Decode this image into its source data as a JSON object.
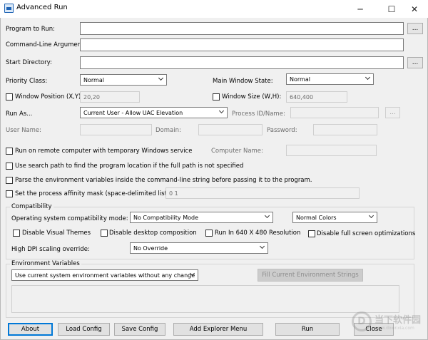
{
  "window": {
    "title": "Advanced Run",
    "minimize": "─",
    "maximize": "☐",
    "close": "✕"
  },
  "labels": {
    "program": "Program to Run:",
    "args": "Command-Line Arguments:",
    "startdir": "Start Directory:",
    "priority": "Priority Class:",
    "main_window_state": "Main Window State:",
    "window_position": "Window Position (X,Y):",
    "window_size": "Window Size (W,H):",
    "run_as": "Run As...",
    "process_id": "Process ID/Name:",
    "user_name": "User Name:",
    "domain": "Domain:",
    "password": "Password:",
    "computer_name": "Computer Name:"
  },
  "values": {
    "program": "",
    "args": "",
    "startdir": "",
    "priority": "Normal",
    "main_window_state": "Normal",
    "window_position": "20,20",
    "window_size": "640,400",
    "run_as": "Current User - Allow UAC Elevation",
    "affinity_mask": "0 1"
  },
  "browse": "...",
  "checkboxes": {
    "remote": "Run on remote computer with temporary Windows service",
    "search_path": "Use search path to find the program location if the full path is not specified",
    "parse_env": "Parse the environment variables inside the command-line string before passing it to the program.",
    "affinity": "Set the process affinity mask (space-delimited list):"
  },
  "compatibility": {
    "legend": "Compatibility",
    "os_mode_label": "Operating system compatibility mode:",
    "os_mode": "No Compatibility Mode",
    "colors": "Normal Colors",
    "disable_visual_themes": "Disable Visual Themes",
    "disable_desktop_composition": "Disable desktop composition",
    "run_640": "Run In 640 X 480 Resolution",
    "disable_fullscreen_opt": "Disable full screen optimizations",
    "dpi_label": "High DPI scaling override:",
    "dpi": "No Override"
  },
  "environment": {
    "legend": "Environment Variables",
    "mode": "Use current system environment variables without any change",
    "fill_button": "Fill Current Environment Strings"
  },
  "buttons": {
    "about": "About",
    "load": "Load Config",
    "save": "Save Config",
    "explorer": "Add Explorer Menu",
    "run": "Run",
    "close": "Close"
  },
  "watermark": {
    "text": "当下软件园",
    "url": "www.downxia.com",
    "glyph": "D"
  }
}
